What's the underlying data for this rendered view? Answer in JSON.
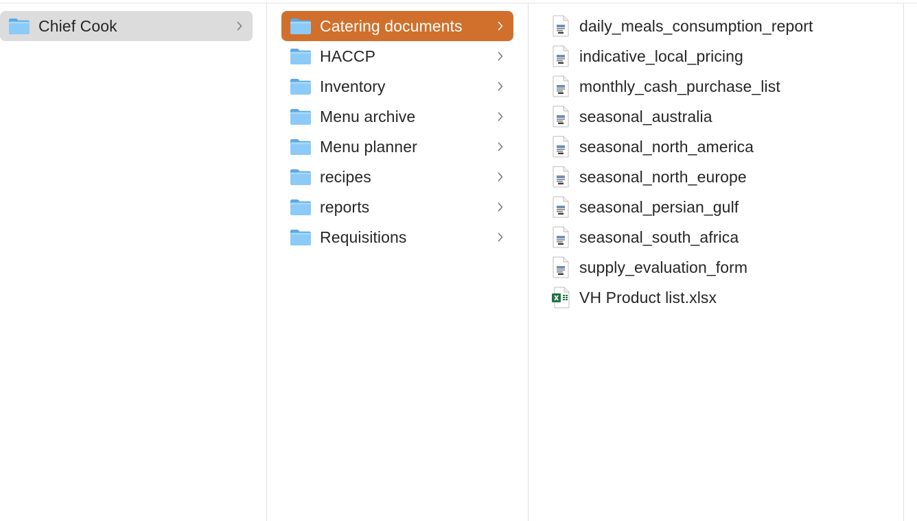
{
  "columns": {
    "root": {
      "items": [
        {
          "label": "Chief Cook",
          "icon": "folder-icon",
          "selected": true,
          "has_children": true
        }
      ]
    },
    "chief_cook": {
      "items": [
        {
          "label": "Catering documents",
          "icon": "folder-icon",
          "selected": true
        },
        {
          "label": "HACCP",
          "icon": "folder-icon"
        },
        {
          "label": "Inventory",
          "icon": "folder-icon"
        },
        {
          "label": "Menu archive",
          "icon": "folder-icon"
        },
        {
          "label": "Menu planner",
          "icon": "folder-icon"
        },
        {
          "label": "recipes",
          "icon": "folder-icon"
        },
        {
          "label": "reports",
          "icon": "folder-icon"
        },
        {
          "label": "Requisitions",
          "icon": "folder-icon"
        }
      ]
    },
    "catering_documents": {
      "items": [
        {
          "label": "daily_meals_consumption_report",
          "icon": "document-icon"
        },
        {
          "label": "indicative_local_pricing",
          "icon": "document-icon"
        },
        {
          "label": "monthly_cash_purchase_list",
          "icon": "document-icon"
        },
        {
          "label": "seasonal_australia",
          "icon": "document-icon"
        },
        {
          "label": "seasonal_north_america",
          "icon": "document-icon"
        },
        {
          "label": "seasonal_north_europe",
          "icon": "document-icon"
        },
        {
          "label": "seasonal_persian_gulf",
          "icon": "document-icon"
        },
        {
          "label": "seasonal_south_africa",
          "icon": "document-icon"
        },
        {
          "label": "supply_evaluation_form",
          "icon": "document-icon"
        },
        {
          "label": "VH Product list.xlsx",
          "icon": "excel-file-icon"
        }
      ]
    }
  },
  "colors": {
    "selected_active": "#d0702c",
    "selected_inactive": "#dcdcdc",
    "folder_blue": "#7cc1f3",
    "excel_green": "#1f7244"
  }
}
